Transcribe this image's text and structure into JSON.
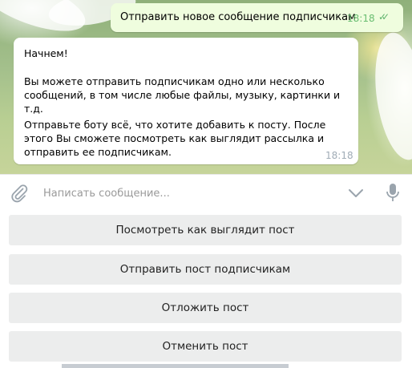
{
  "messages": {
    "outgoing": {
      "text": "Отправить новое сообщение подписчикам",
      "time": "18:18"
    },
    "incoming": {
      "line1": "Начнем!",
      "line2": "Вы можете отправить подписчикам одно или несколько сообщений, в том числе любые файлы, музыку, картинки и т.д.",
      "line3": "Отправьте боту всё, что хотите добавить к посту. После этого Вы сможете посмотреть как выглядит рассылка и отправить ее подписчикам.",
      "time": "18:18"
    }
  },
  "composer": {
    "placeholder": "Написать сообщение..."
  },
  "keyboard": {
    "buttons": [
      "Посмотреть как выглядит пост",
      "Отправить пост подписчикам",
      "Отложить пост",
      "Отменить пост"
    ]
  },
  "icons": {
    "attach": "paperclip-icon",
    "keyboard_toggle": "chevron-down-icon",
    "voice": "microphone-icon",
    "read_status": "double-check-icon"
  },
  "colors": {
    "outgoing_bubble": "#effdde",
    "incoming_bubble": "#ffffff",
    "read_check": "#5fb46c",
    "keyboard_button": "#eceded"
  }
}
